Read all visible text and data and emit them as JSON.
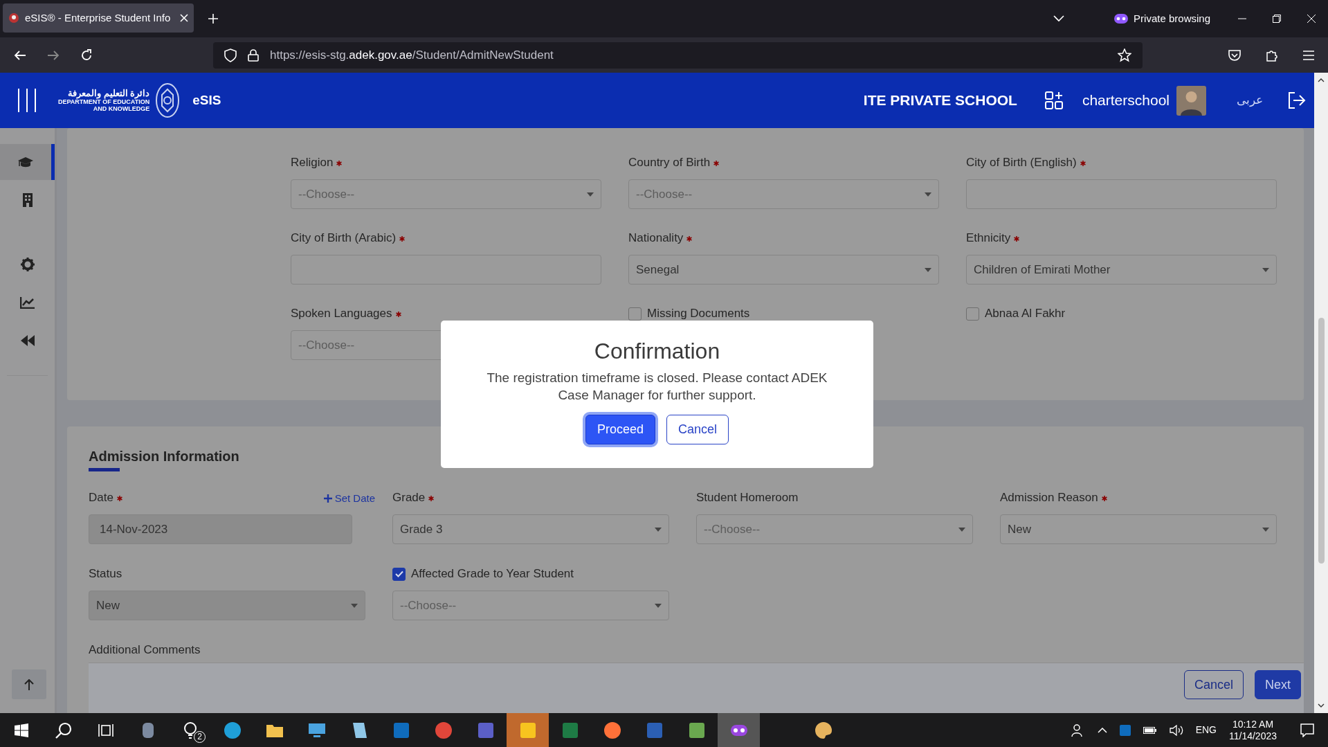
{
  "browser": {
    "tab_title": "eSIS® - Enterprise Student Info",
    "url": {
      "scheme": "https://esis-stg.",
      "domain": "adek.gov.ae",
      "path": "/Student/AdmitNewStudent"
    },
    "private_label": "Private browsing"
  },
  "header": {
    "logo_arabic": "دائرة التعليم والمعرفة",
    "logo_english": [
      "DEPARTMENT OF EDUCATION",
      "AND KNOWLEDGE"
    ],
    "app_name": "eSIS",
    "school": "ITE PRIVATE SCHOOL",
    "user": "charterschool",
    "language": "عربى"
  },
  "sidebar": {
    "items": [
      {
        "kind": "graduation",
        "selected": true
      },
      {
        "kind": "building",
        "selected": false
      },
      {
        "kind": "gear",
        "selected": false
      },
      {
        "kind": "chart",
        "selected": false
      },
      {
        "kind": "rewind",
        "selected": false
      }
    ]
  },
  "student_form": {
    "rows": [
      [
        {
          "kind": "select",
          "label": "Religion",
          "required": true,
          "placeholder": "--Choose--"
        },
        {
          "kind": "select",
          "label": "Country of Birth",
          "required": true,
          "placeholder": "--Choose--"
        },
        {
          "kind": "text",
          "label": "City of Birth (English)",
          "required": true
        }
      ],
      [
        {
          "kind": "text",
          "label": "City of Birth (Arabic)",
          "required": true
        },
        {
          "kind": "select",
          "label": "Nationality",
          "required": true,
          "value": "Senegal"
        },
        {
          "kind": "select",
          "label": "Ethnicity",
          "required": true,
          "value": "Children of Emirati Mother"
        }
      ],
      [
        {
          "kind": "select",
          "label": "Spoken Languages",
          "required": true,
          "placeholder": "--Choose--"
        },
        {
          "kind": "checkbox",
          "label": "Missing Documents",
          "checked": false
        },
        {
          "kind": "checkbox",
          "label": "Abnaa Al Fakhr",
          "checked": false
        }
      ]
    ]
  },
  "admission": {
    "title": "Admission Information",
    "rows": [
      [
        {
          "kind": "date",
          "label": "Date",
          "required": true,
          "action": "Set Date",
          "value": "14-Nov-2023",
          "disabled": true
        },
        {
          "kind": "select",
          "label": "Grade",
          "required": true,
          "value": "Grade 3"
        },
        {
          "kind": "select",
          "label": "Student Homeroom",
          "required": false,
          "placeholder": "--Choose--"
        },
        {
          "kind": "select",
          "label": "Admission Reason",
          "required": true,
          "value": "New"
        }
      ],
      [
        {
          "kind": "select",
          "label": "Status",
          "required": false,
          "value": "New",
          "disabled": true
        },
        {
          "kind": "checkbox-select",
          "label": "Affected Grade to Year Student",
          "checked": true,
          "placeholder": "--Choose--"
        }
      ]
    ],
    "comments_label": "Additional Comments"
  },
  "footer_buttons": [
    {
      "label": "Cancel",
      "kind": "outline"
    },
    {
      "label": "Next",
      "kind": "primary"
    }
  ],
  "modal": {
    "title": "Confirmation",
    "message": "The registration timeframe is closed. Please contact ADEK Case Manager for further support.",
    "buttons": [
      {
        "label": "Proceed",
        "kind": "primary",
        "focused": true
      },
      {
        "label": "Cancel",
        "kind": "outline",
        "focused": false
      }
    ]
  },
  "taskbar": {
    "notification_count": "2",
    "language": "ENG",
    "time": "10:12 AM",
    "date": "11/14/2023"
  }
}
